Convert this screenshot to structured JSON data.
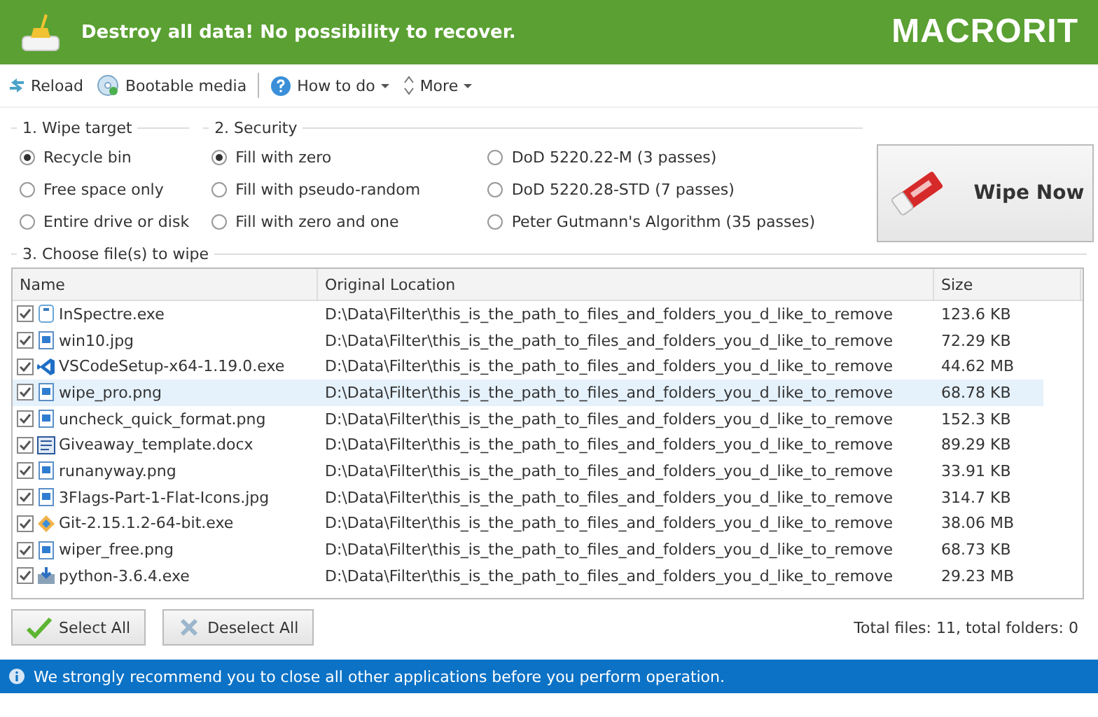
{
  "header": {
    "logo": "MACRORIT",
    "message": "Destroy all data! No possibility to recover."
  },
  "toolbar": [
    {
      "label": "Reload",
      "kind": "reload",
      "dropdown": false
    },
    {
      "label": "Bootable media",
      "kind": "disc",
      "dropdown": false
    },
    {
      "label": "How to do",
      "kind": "help",
      "dropdown": true
    },
    {
      "label": "More",
      "kind": "updown",
      "dropdown": true
    }
  ],
  "wipe_target": {
    "title": "1. Wipe target",
    "options": [
      {
        "label": "Recycle bin",
        "selected": true
      },
      {
        "label": "Free space only",
        "selected": false
      },
      {
        "label": "Entire drive or disk",
        "selected": false
      }
    ]
  },
  "security": {
    "title": "2. Security",
    "options": [
      {
        "label": "Fill with zero",
        "selected": true
      },
      {
        "label": "Fill with pseudo-random",
        "selected": false
      },
      {
        "label": "Fill with zero and one",
        "selected": false
      },
      {
        "label": "DoD 5220.22-M (3 passes)",
        "selected": false
      },
      {
        "label": "DoD 5220.28-STD (7 passes)",
        "selected": false
      },
      {
        "label": "Peter Gutmann's Algorithm (35 passes)",
        "selected": false
      }
    ]
  },
  "wipe_button": "Wipe Now",
  "files": {
    "title": "3. Choose file(s) to wipe",
    "columns": [
      "Name",
      "Original Location",
      "Size"
    ],
    "rows": [
      {
        "name": "InSpectre.exe",
        "location": "D:\\Data\\Filter\\this_is_the_path_to_files_and_folders_you_d_like_to_remove",
        "size": "123.6 KB",
        "checked": true,
        "selected": false,
        "kind": "app"
      },
      {
        "name": "win10.jpg",
        "location": "D:\\Data\\Filter\\this_is_the_path_to_files_and_folders_you_d_like_to_remove",
        "size": "72.29 KB",
        "checked": true,
        "selected": false,
        "kind": "image"
      },
      {
        "name": "VSCodeSetup-x64-1.19.0.exe",
        "location": "D:\\Data\\Filter\\this_is_the_path_to_files_and_folders_you_d_like_to_remove",
        "size": "44.62 MB",
        "checked": true,
        "selected": false,
        "kind": "code"
      },
      {
        "name": "wipe_pro.png",
        "location": "D:\\Data\\Filter\\this_is_the_path_to_files_and_folders_you_d_like_to_remove",
        "size": "68.78 KB",
        "checked": true,
        "selected": true,
        "kind": "image"
      },
      {
        "name": "uncheck_quick_format.png",
        "location": "D:\\Data\\Filter\\this_is_the_path_to_files_and_folders_you_d_like_to_remove",
        "size": "152.3 KB",
        "checked": true,
        "selected": false,
        "kind": "image"
      },
      {
        "name": "Giveaway_template.docx",
        "location": "D:\\Data\\Filter\\this_is_the_path_to_files_and_folders_you_d_like_to_remove",
        "size": "89.29 KB",
        "checked": true,
        "selected": false,
        "kind": "doc"
      },
      {
        "name": "runanyway.png",
        "location": "D:\\Data\\Filter\\this_is_the_path_to_files_and_folders_you_d_like_to_remove",
        "size": "33.91 KB",
        "checked": true,
        "selected": false,
        "kind": "image"
      },
      {
        "name": "3Flags-Part-1-Flat-Icons.jpg",
        "location": "D:\\Data\\Filter\\this_is_the_path_to_files_and_folders_you_d_like_to_remove",
        "size": "314.7 KB",
        "checked": true,
        "selected": false,
        "kind": "image"
      },
      {
        "name": "Git-2.15.1.2-64-bit.exe",
        "location": "D:\\Data\\Filter\\this_is_the_path_to_files_and_folders_you_d_like_to_remove",
        "size": "38.06 MB",
        "checked": true,
        "selected": false,
        "kind": "git"
      },
      {
        "name": "wiper_free.png",
        "location": "D:\\Data\\Filter\\this_is_the_path_to_files_and_folders_you_d_like_to_remove",
        "size": "68.73 KB",
        "checked": true,
        "selected": false,
        "kind": "image"
      },
      {
        "name": "python-3.6.4.exe",
        "location": "D:\\Data\\Filter\\this_is_the_path_to_files_and_folders_you_d_like_to_remove",
        "size": "29.23 MB",
        "checked": true,
        "selected": false,
        "kind": "installer"
      }
    ]
  },
  "select_all": "Select All",
  "deselect_all": "Deselect All",
  "totals": "Total files: 11, total folders: 0",
  "status_bar": "We strongly recommend you to close all other applications before you perform operation."
}
